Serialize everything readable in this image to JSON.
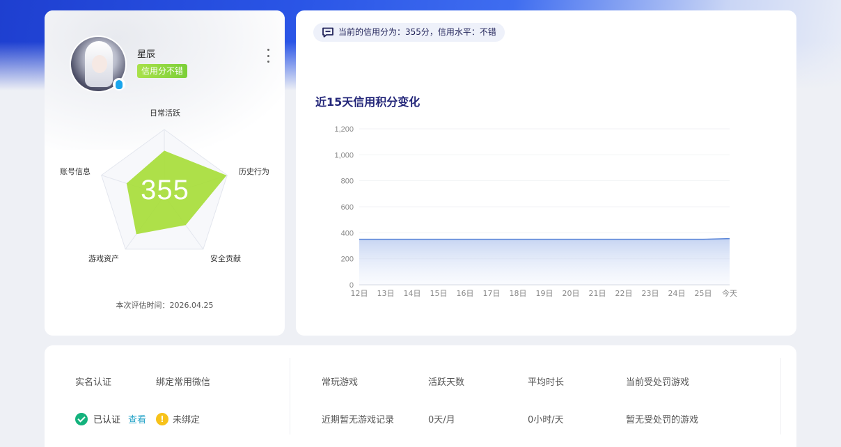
{
  "profile": {
    "username": "星辰",
    "credit_tag": "信用分不错",
    "score": "355",
    "radar_labels": {
      "top": "日常活跃",
      "right": "历史行为",
      "bottom_right": "安全贡献",
      "bottom_left": "游戏资产",
      "left": "账号信息"
    },
    "eval_time_label": "本次评估时间：",
    "eval_time_value": "2026.04.25"
  },
  "notice": {
    "text": "当前的信用分为：355分，信用水平：不错"
  },
  "chart": {
    "title": "近15天信用积分变化"
  },
  "chart_data": {
    "type": "area",
    "title": "近15天信用积分变化",
    "xlabel": "",
    "ylabel": "",
    "categories": [
      "12日",
      "13日",
      "14日",
      "15日",
      "16日",
      "17日",
      "18日",
      "19日",
      "20日",
      "21日",
      "22日",
      "23日",
      "24日",
      "25日",
      "今天"
    ],
    "values": [
      350,
      350,
      350,
      350,
      350,
      350,
      350,
      350,
      350,
      350,
      350,
      350,
      350,
      350,
      355
    ],
    "yticks": [
      "0",
      "200",
      "400",
      "600",
      "800",
      "1,000",
      "1,200"
    ],
    "ylim": [
      0,
      1200
    ],
    "grid": true,
    "line_color": "#5b86d8"
  },
  "info": {
    "real_name_label": "实名认证",
    "wechat_label": "绑定常用微信",
    "verified_text": "已认证",
    "view_link": "查看",
    "unbound_text": "未绑定",
    "common_game_label": "常玩游戏",
    "active_days_label": "活跃天数",
    "avg_time_label": "平均时长",
    "penalty_label": "当前受处罚游戏",
    "common_game_value": "近期暂无游戏记录",
    "active_days_value": "0天/月",
    "avg_time_value": "0小时/天",
    "penalty_value": "暂无受处罚的游戏"
  }
}
